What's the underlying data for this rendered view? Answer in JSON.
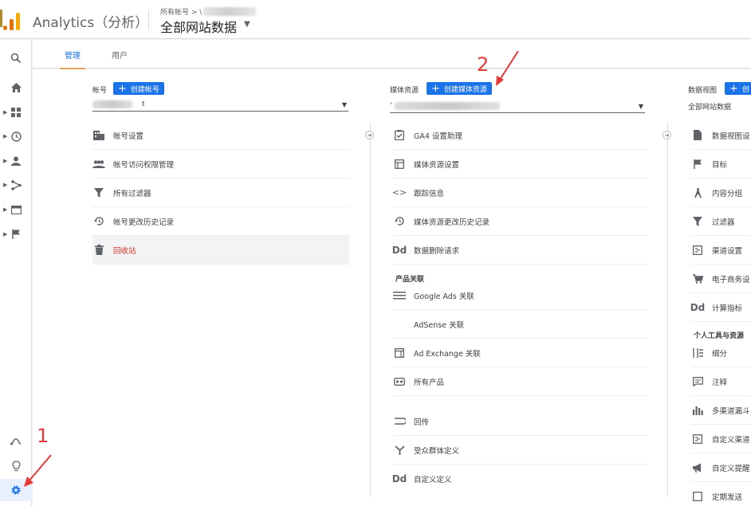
{
  "header": {
    "app_title": "Analytics（分析）",
    "breadcrumb": "所有帐号 > \\",
    "view_name": "全部网站数据"
  },
  "tabs": [
    {
      "label": "管理",
      "active": true
    },
    {
      "label": "用户",
      "active": false
    }
  ],
  "account": {
    "label": "帐号",
    "create_label": "创建帐号",
    "selected_suffix": "t",
    "items": [
      {
        "icon": "building-icon",
        "label": "帐号设置"
      },
      {
        "icon": "people-icon",
        "label": "帐号访问权限管理"
      },
      {
        "icon": "filter-icon",
        "label": "所有过滤器"
      },
      {
        "icon": "history-icon",
        "label": "帐号更改历史记录"
      },
      {
        "icon": "trash-icon",
        "label": "回收站"
      }
    ]
  },
  "property": {
    "label": "媒体资源",
    "create_label": "创建媒体资源",
    "selected_prefix": "'",
    "items": [
      {
        "icon": "checklist-icon",
        "label": "GA4 设置助理"
      },
      {
        "icon": "layout-icon",
        "label": "媒体资源设置"
      },
      {
        "icon": "code-icon",
        "label": "跟踪信息"
      },
      {
        "icon": "history-icon",
        "label": "媒体资源更改历史记录"
      },
      {
        "icon": "dd-icon",
        "label": "数据删除请求"
      }
    ],
    "product_section": "产品关联",
    "product_items": [
      {
        "icon": "ads-icon",
        "label": "Google Ads 关联"
      },
      {
        "icon": "adsense-icon",
        "label": "AdSense 关联"
      },
      {
        "icon": "adexchange-icon",
        "label": "Ad Exchange 关联"
      },
      {
        "icon": "link-icon",
        "label": "所有产品"
      }
    ],
    "more_items": [
      {
        "icon": "postback-icon",
        "label": "回传"
      },
      {
        "icon": "audience-icon",
        "label": "受众群体定义"
      },
      {
        "icon": "dd-icon",
        "label": "自定义定义"
      }
    ]
  },
  "view": {
    "label": "数据视图",
    "create_label": "创",
    "selected": "全部网站数据",
    "items": [
      {
        "icon": "doc-icon",
        "label": "数据视图设"
      },
      {
        "icon": "flag-icon",
        "label": "目标"
      },
      {
        "icon": "walk-icon",
        "label": "内容分组"
      },
      {
        "icon": "filter-icon",
        "label": "过滤器"
      },
      {
        "icon": "channel-icon",
        "label": "渠道设置"
      },
      {
        "icon": "cart-icon",
        "label": "电子商务设"
      },
      {
        "icon": "dd-icon",
        "label": "计算指标"
      }
    ],
    "tools_section": "个人工具与资源",
    "tools_items": [
      {
        "icon": "segment-icon",
        "label": "细分"
      },
      {
        "icon": "annotation-icon",
        "label": "注释"
      },
      {
        "icon": "bar-chart-icon",
        "label": "多渠道漏斗"
      },
      {
        "icon": "channel-icon",
        "label": "自定义渠道"
      },
      {
        "icon": "megaphone-icon",
        "label": "自定义提醒"
      },
      {
        "icon": "schedule-icon",
        "label": "定期发送"
      }
    ]
  },
  "annotations": {
    "one": "1",
    "two": "2"
  },
  "colors": {
    "accent": "#1a73e8",
    "annotation": "#e53935",
    "trash_text": "#d93025"
  }
}
